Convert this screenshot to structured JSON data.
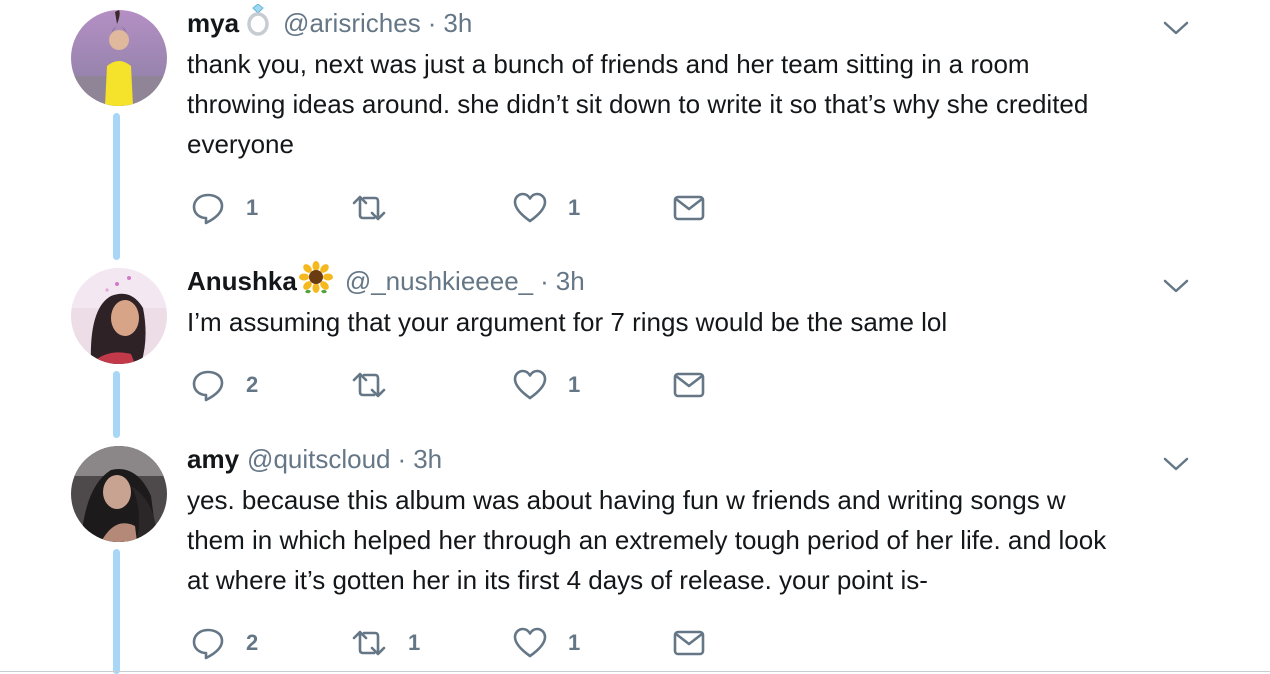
{
  "tweets": [
    {
      "name": "mya",
      "emoji": "💍",
      "emoji_icon": "ring-icon",
      "handle": "@arisriches",
      "separator": "·",
      "time": "3h",
      "text_lines": [
        "thank you, next was just a bunch of friends and her team sitting in a room",
        "throwing ideas around. she didn’t sit down to write it so that’s why she credited",
        "everyone"
      ],
      "reply_count": "1",
      "retweet_count": "",
      "like_count": "1"
    },
    {
      "name": "Anushka",
      "emoji": "🌻",
      "emoji_icon": "sunflower-icon",
      "handle": "@_nushkieeee_",
      "separator": "·",
      "time": "3h",
      "text_lines": [
        "I’m assuming that your argument for 7 rings would be the same lol"
      ],
      "reply_count": "2",
      "retweet_count": "",
      "like_count": "1"
    },
    {
      "name": "amy",
      "emoji": "",
      "emoji_icon": "",
      "handle": "@quitscloud",
      "separator": "·",
      "time": "3h",
      "text_lines": [
        "yes. because this album was about having fun w friends and writing songs w",
        "them in which helped her through an extremely tough period of her life. and look",
        "at where it’s gotten her in its first 4 days of release. your point is-"
      ],
      "reply_count": "2",
      "retweet_count": "1",
      "like_count": "1"
    }
  ],
  "icons": {
    "reply": "reply-icon",
    "retweet": "retweet-icon",
    "like": "heart-icon",
    "message": "direct-message-icon",
    "caret": "chevron-down-icon"
  },
  "colors": {
    "text": "#14171a",
    "secondary": "#657786",
    "thread_line": "#a7d6f7"
  }
}
